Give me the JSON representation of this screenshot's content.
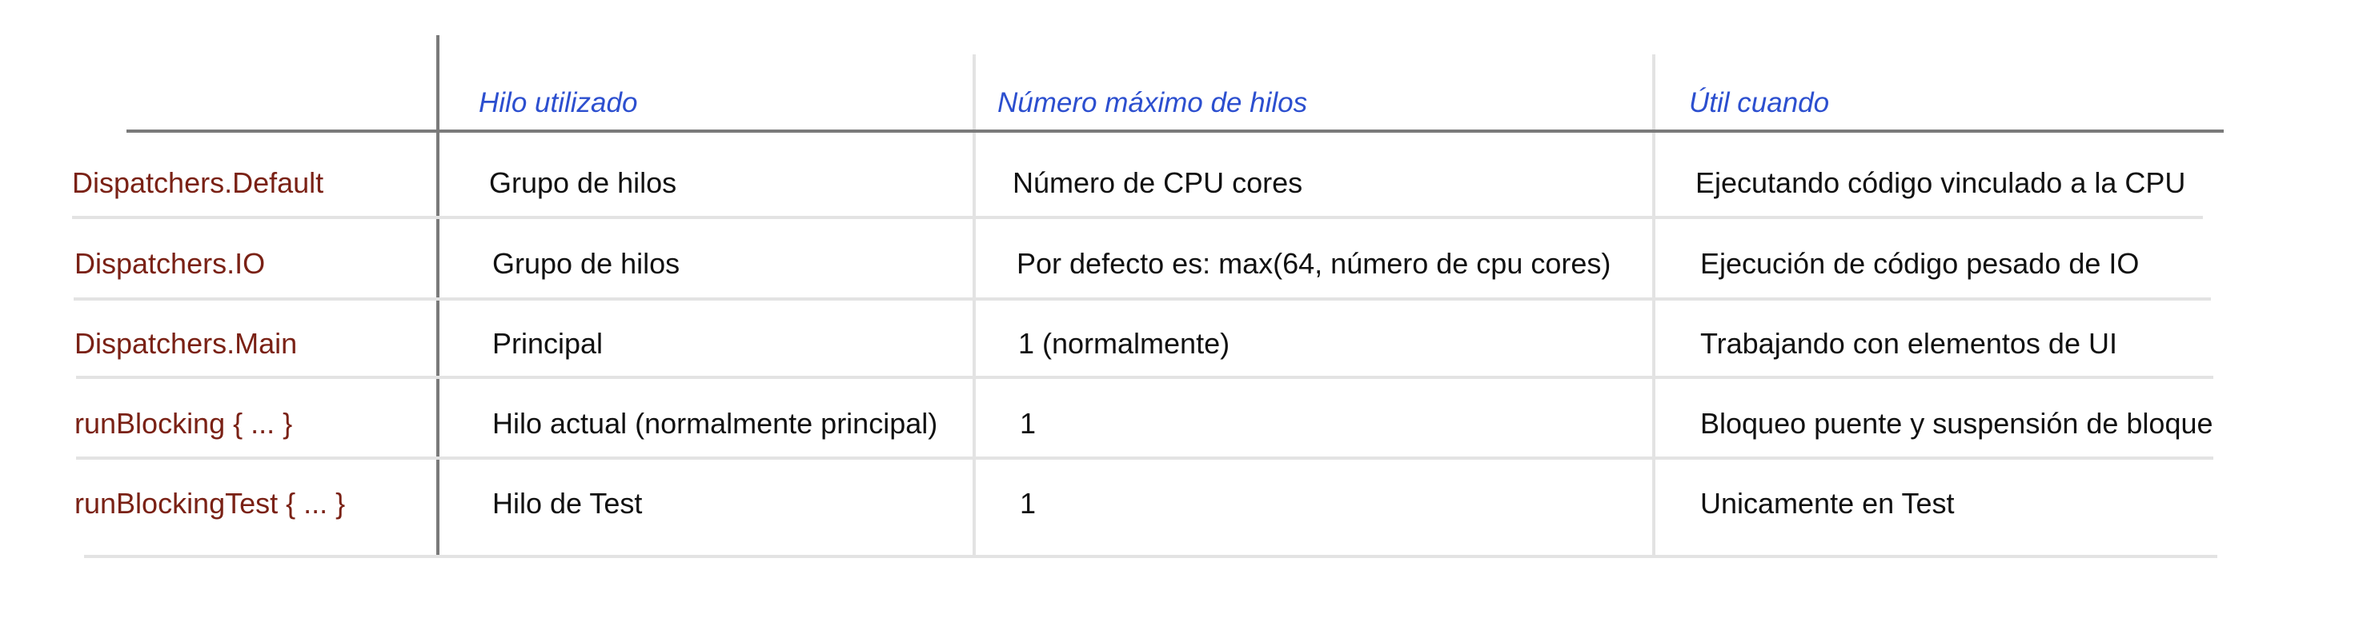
{
  "table": {
    "headers": [
      "Hilo utilizado",
      "Número máximo de hilos",
      "Útil cuando"
    ],
    "rows": [
      {
        "dispatcher": "Dispatchers.Default",
        "thread": "Grupo de hilos",
        "max_threads": "Número de CPU cores",
        "useful_when": "Ejecutando código vinculado a la CPU"
      },
      {
        "dispatcher": "Dispatchers.IO",
        "thread": "Grupo de hilos",
        "max_threads": "Por defecto es: max(64, número de cpu cores)",
        "useful_when": "Ejecución de código pesado de IO"
      },
      {
        "dispatcher": "Dispatchers.Main",
        "thread": "Principal",
        "max_threads": "1 (normalmente)",
        "useful_when": "Trabajando con elementos de UI"
      },
      {
        "dispatcher": "runBlocking { ... }",
        "thread": "Hilo actual (normalmente principal)",
        "max_threads": "1",
        "useful_when": "Bloqueo puente y suspensión de bloque"
      },
      {
        "dispatcher": "runBlockingTest { ... }",
        "thread": "Hilo de Test",
        "max_threads": "1",
        "useful_when": "Unicamente en Test"
      }
    ]
  },
  "colors": {
    "header_text": "#2c4fcf",
    "dispatcher_text": "#7a2115",
    "body_text": "#111111",
    "divider": "#7a7a7a",
    "grid": "#e3e3e3"
  }
}
